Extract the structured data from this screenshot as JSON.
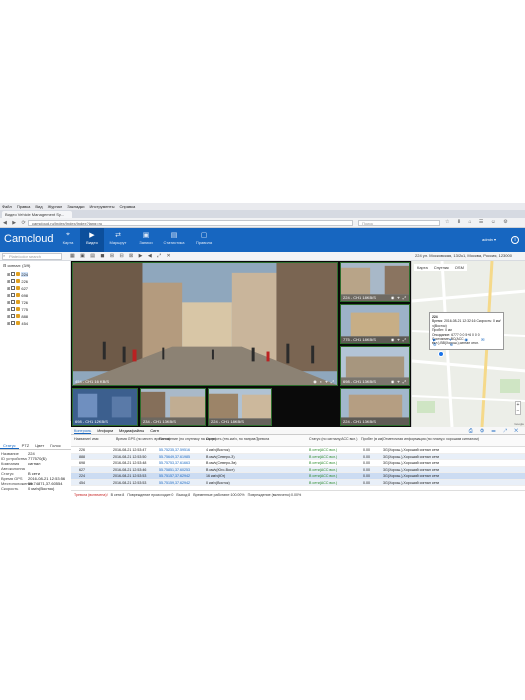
{
  "browser": {
    "menu": [
      "Файл",
      "Правка",
      "Вид",
      "Журнал",
      "Закладки",
      "Инструменты",
      "Справка"
    ],
    "tab_title": "Видео Vehicle Management Sy...",
    "url": "camcloud.ru/Index/Index/Index?lang=ru",
    "search_placeholder": "Поиск"
  },
  "app": {
    "logo": "Camcloud",
    "nav": [
      {
        "label": "Карта",
        "icon": "map-pin-icon"
      },
      {
        "label": "Видео",
        "icon": "play-circle-icon"
      },
      {
        "label": "Маршрут",
        "icon": "route-icon"
      },
      {
        "label": "Записи",
        "icon": "records-icon"
      },
      {
        "label": "Статистика",
        "icon": "chart-icon"
      },
      {
        "label": "Правила",
        "icon": "rules-icon"
      }
    ],
    "user": "admin ▾",
    "accent": "#1766c0"
  },
  "toolbar": {
    "tree_search_placeholder": "Plate/color search",
    "location": "224 ул. Московская, 13/2к1, Москва, Россия, 123000"
  },
  "tree": {
    "root": "сигнал: (3/9)",
    "items": [
      "224",
      "226",
      "627",
      "698",
      "726",
      "775",
      "888",
      "454"
    ],
    "selected": "224"
  },
  "cameras": [
    {
      "label": "454 - CH1 16 KB/S"
    },
    {
      "label": "224 - CH1 18KB/S"
    },
    {
      "label": "775 - CH1 18KB/S"
    },
    {
      "label": "698 - CH1 13KB/S"
    },
    {
      "label": "698 - CH1 12KB/S"
    },
    {
      "label": "234 - CH1 13KB/S"
    },
    {
      "label": "224 - CH1 18KB/S"
    },
    {
      "label": "224 - CH1 13KB/S"
    }
  ],
  "map": {
    "tabs": [
      "Карта",
      "Спутник",
      "OSM"
    ],
    "popup": {
      "title": "224",
      "time": "Время: 2016-08-21 12:32:16   Скорость: 0 км/ч(Восток)",
      "mileage": "Пробег: 0 км",
      "status": "Опоздание: 6777 0 0 5+6 0 0 0",
      "state": "Состояние: ВС(АСС вкл.),ВВ(Хорош.),сигнал откл."
    },
    "attribution": "Google"
  },
  "bottom_tabs": [
    "Контроль",
    "Информ",
    "Медиафайлы",
    "Сигн"
  ],
  "table": {
    "headers": [
      "Название/ имя",
      "Время GPS\n(по местн. времени)",
      "Положение\n(по спутнику на карте)",
      "Скорость\n(тек.км/ч, по направ.)",
      "Тревога",
      "Статус\n(по сигналу,АСС вкл.)",
      "Пробег\n(в км)",
      "Отметочная информация\n(по плану,с хорошим сигналом)"
    ],
    "rows": [
      [
        "226",
        "2016-08-21 12:53:47",
        "55.75235,37.59516",
        "4 км/ч(Восток)",
        "",
        "В сети(АСС вкл.)",
        "0.00",
        "3G(Хорош.),Хороший сигнал сети"
      ],
      [
        "888",
        "2016-08-21 12:53:50",
        "55.75649,37.61985",
        "В км/ч(Северо-З)",
        "",
        "В сети(АСС вкл.)",
        "0.00",
        "3G(Хорош.),Хороший сигнал сети"
      ],
      [
        "698",
        "2016-08-21 12:53:48",
        "55.75753,37.61663",
        "В км/ч(Северо-Зв)",
        "",
        "В сети(АСС вкл.)",
        "0.00",
        "3G(Хорош.),Хороший сигнал сети"
      ],
      [
        "627",
        "2016-08-21 12:53:46",
        "55.75851,37.60253",
        "В км/ч(Юго-Вост)",
        "",
        "В сети(АСС вкл.)",
        "0.00",
        "3G(Хорош.),Хороший сигнал сети"
      ],
      [
        "224",
        "2016-08-21 12:53:53",
        "55.75157,37.62942",
        "16 км/ч(Юг)",
        "",
        "В сети(АСС вкл.)",
        "0.00",
        "3G(Хорош.),Хороший сигнал сети"
      ],
      [
        "454",
        "2016-08-21 12:53:53",
        "55.75159,37.62942",
        "0 км/ч(Восток)",
        "",
        "В сети(АСС вкл.)",
        "0.00",
        "3G(Хорош.),Хороший сигнал сети"
      ]
    ]
  },
  "status_bar": {
    "alarm": "Тревога (включена)!",
    "online": "В сети:8",
    "loss": "Повреждение происходит:0",
    "offline": "Выход:8",
    "ok": "Временные работают:100.00%",
    "damage": "Повреждение (включено):0.00%"
  },
  "info_panel": {
    "tabs": [
      "Статус",
      "PTZ",
      "Цвет",
      "Голос"
    ],
    "rows": [
      {
        "k": "Название",
        "v": "224"
      },
      {
        "k": "ID устройства",
        "v": "777570(Б)"
      },
      {
        "k": "Компания",
        "v": "сигнал"
      },
      {
        "k": "Автоколонна",
        "v": ""
      },
      {
        "k": "Статус",
        "v": "В сети"
      },
      {
        "k": "Время GPS",
        "v": "2016-08-21 12:53:56"
      },
      {
        "k": "Местоположение",
        "v": "55.74871,37.60554"
      },
      {
        "k": "Скорость",
        "v": "0 км/ч(Восток)"
      }
    ]
  }
}
